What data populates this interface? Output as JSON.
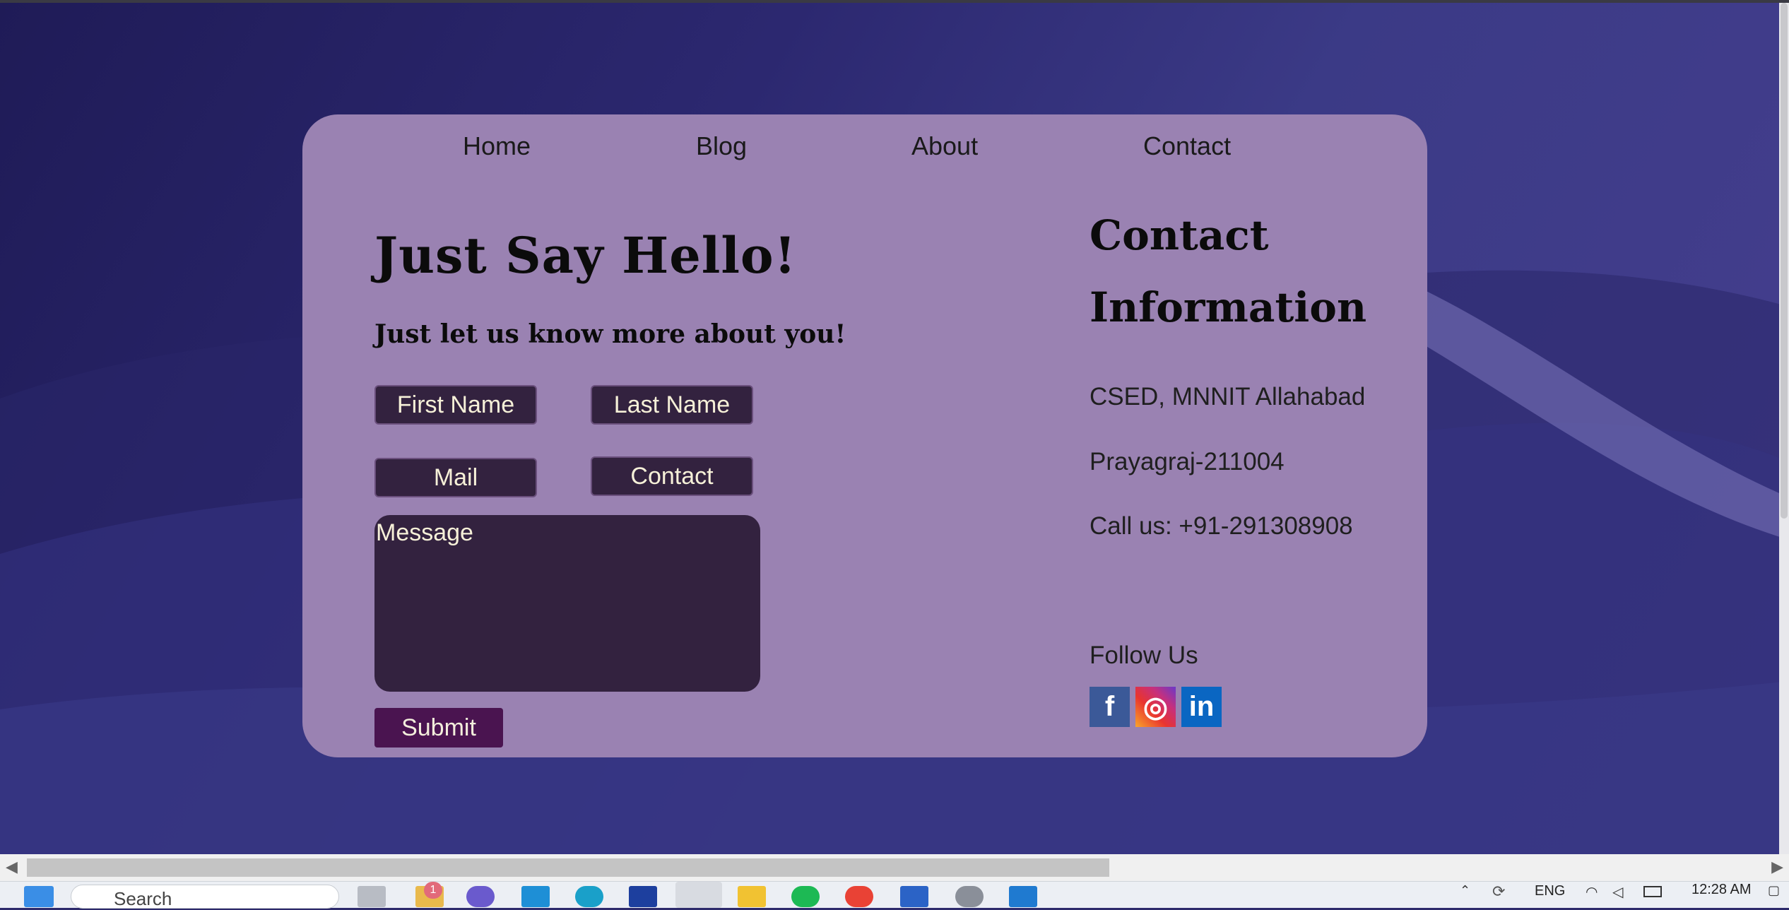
{
  "nav": {
    "items": [
      {
        "label": "Home"
      },
      {
        "label": "Blog"
      },
      {
        "label": "About"
      },
      {
        "label": "Contact"
      }
    ]
  },
  "form": {
    "title": "Just Say Hello!",
    "subtitle": "Just let us know more about you!",
    "first_name_placeholder": "First Name",
    "last_name_placeholder": "Last Name",
    "mail_placeholder": "Mail",
    "contact_placeholder": "Contact",
    "message_placeholder": "Message",
    "submit_label": "Submit"
  },
  "contact_info": {
    "title": "Contact Information",
    "address_line1": "CSED, MNNIT Allahabad",
    "address_line2": "Prayagraj-211004",
    "phone": "Call us: +91-291308908",
    "follow_label": "Follow Us",
    "social": [
      {
        "icon": "facebook-icon",
        "glyph": "f"
      },
      {
        "icon": "instagram-icon",
        "glyph": "◎"
      },
      {
        "icon": "linkedin-icon",
        "glyph": "in"
      }
    ]
  },
  "taskbar": {
    "search_placeholder": "Search",
    "language": "ENG",
    "time": "12:28 AM",
    "notification_badge": "1"
  },
  "colors": {
    "card_bg": "#9a82b2",
    "field_bg": "#33223f",
    "submit_bg": "#4a1450"
  }
}
